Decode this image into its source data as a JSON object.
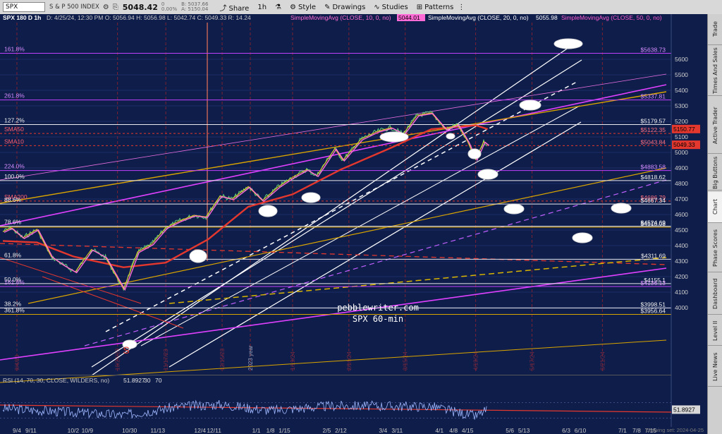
{
  "toolbar": {
    "symbol": "SPX",
    "description": "S & P 500 INDEX",
    "price": "5048.42",
    "change_line1": "0",
    "change_line2": "0.00%",
    "bid": "B: 5037.66",
    "ask": "A: 5150.04",
    "share_label": "Share",
    "timeframe_label": "1h",
    "style_label": "Style",
    "drawings_label": "Drawings",
    "studies_label": "Studies",
    "patterns_label": "Patterns"
  },
  "side_tabs": [
    "Trade",
    "Times And Sales",
    "Active Trader",
    "Big Buttons",
    "Chart",
    "Phase Scores",
    "Dashboard",
    "Level II",
    "Live News"
  ],
  "chart_header": {
    "title": "SPX 180 D 1h",
    "ohlc": "D: 4/25/24, 12:30 PM  O: 5056.94  H: 5056.98  L: 5042.74  C: 5049.33  R: 14.24",
    "sma10_label": "SimpleMovingAvg (CLOSE, 10, 0, no)",
    "sma10_value": "5044.01",
    "sma20_label": "SimpleMovingAvg (CLOSE, 20, 0, no)",
    "sma20_value": "5055.98",
    "sma50_label": "SimpleMovingAvg (CLOSE, 50, 0, no)"
  },
  "rsi_header": {
    "label": "RSI (14, 70, 30, CLOSE, WILDERS, no)",
    "value": "51.8927",
    "ob": "30",
    "os": "70"
  },
  "watermark": {
    "line1": "pebblewriter.com",
    "line2": "SPX 60-min"
  },
  "signature": "Drawing set: 2024-04-25",
  "s_marker": "S",
  "colors": {
    "background": "#0f1d4a",
    "sma10": "#ff6bd6",
    "sma20": "#f5d020",
    "sma50": "#e4382e",
    "fib": "#c040ff",
    "channel": "#ffffff",
    "gold": "#d9a400"
  },
  "chart_data": {
    "type": "line",
    "price_axis_ticks": [
      "5600",
      "5500",
      "5400",
      "5300",
      "5200",
      "5100",
      "5000",
      "4900",
      "4800",
      "4700",
      "4600",
      "4500",
      "4400",
      "4300",
      "4200",
      "4100",
      "4000"
    ],
    "x_tick_labels": [
      "9/4",
      "9/11",
      "10/2",
      "10/9",
      "10/30",
      "11/13",
      "12/4",
      "12/11",
      "1/1",
      "1/8",
      "1/15",
      "2/5",
      "2/12",
      "3/4",
      "3/11",
      "4/1",
      "4/8",
      "4/15",
      "5/6",
      "5/13",
      "6/3",
      "6/10",
      "7/1",
      "7/8",
      "7/15"
    ],
    "x_tick_dates": [
      "2023-09-04",
      "2023-09-11",
      "2023-10-02",
      "2023-10-09",
      "2023-10-30",
      "2023-11-13",
      "2023-12-04",
      "2023-12-11",
      "2024-01-01",
      "2024-01-08",
      "2024-01-15",
      "2024-02-05",
      "2024-02-12",
      "2024-03-04",
      "2024-03-11",
      "2024-04-01",
      "2024-04-08",
      "2024-04-15",
      "2024-05-06",
      "2024-05-13",
      "2024-06-03",
      "2024-06-10",
      "2024-07-01",
      "2024-07-08",
      "2024-07-15"
    ],
    "date_markers": [
      {
        "label": "9/4/23",
        "date": "2023-09-04"
      },
      {
        "label": "10/24/23",
        "date": "2023-10-24"
      },
      {
        "label": "11/17/23",
        "date": "2023-11-17"
      },
      {
        "label": "12/15/23",
        "date": "2023-12-15"
      },
      {
        "label": "2023 year",
        "date": "2023-12-29"
      },
      {
        "label": "1/19/24",
        "date": "2024-01-19"
      },
      {
        "label": "2/16/24",
        "date": "2024-02-16"
      },
      {
        "label": "3/15/24",
        "date": "2024-03-15"
      },
      {
        "label": "4/19/24",
        "date": "2024-04-19"
      },
      {
        "label": "5/17/24",
        "date": "2024-05-17"
      },
      {
        "label": "6/21/24",
        "date": "2024-06-21"
      }
    ],
    "level_labels": [
      {
        "label": "161.8%",
        "value": 5638.73,
        "right": "$5638.73",
        "style": "fib"
      },
      {
        "label": "261.8%",
        "value": 5337.81,
        "right": "$5337.81",
        "style": "fib"
      },
      {
        "label": "127.2%",
        "value": 5179.57,
        "right": "$5179.57",
        "style": "white"
      },
      {
        "label": "SMA50",
        "value": 5122.35,
        "right": "$5122.35",
        "style": "sma50"
      },
      {
        "label": "SMA10",
        "value": 5043.84,
        "right": "$5043.84",
        "style": "sma50"
      },
      {
        "label": "224.0%",
        "value": 4883.58,
        "right": "$4883.58",
        "style": "fib"
      },
      {
        "label": "100.0%",
        "value": 4818.62,
        "right": "$4818.62",
        "style": "white"
      },
      {
        "label": "SMA200",
        "value": 4686.79,
        "right": "$4686.79",
        "style": "sma50"
      },
      {
        "label": "88.6%",
        "value": 4667.34,
        "right": "$4667.34",
        "style": "white"
      },
      {
        "label": "78.6%",
        "value": 4524.69,
        "right": "$4524.69",
        "style": "white"
      },
      {
        "label": "",
        "value": 4518.08,
        "right": "$4518.08",
        "style": "gold"
      },
      {
        "label": "61.8%",
        "value": 4311.69,
        "right": "$4311.69",
        "style": "white"
      },
      {
        "label": "50.0%",
        "value": 4155.1,
        "right": "$4155.1",
        "style": "white"
      },
      {
        "label": "161.8%",
        "value": 4136.13,
        "right": "$4136.13",
        "style": "fib"
      },
      {
        "label": "38.2%",
        "value": 3998.51,
        "right": "$3998.51",
        "style": "white"
      },
      {
        "label": "361.8%",
        "value": 3956.64,
        "right": "$3956.64",
        "style": "gold"
      }
    ],
    "price_tags": [
      {
        "value": 5150.77,
        "label": "5150.77",
        "color": "#e4382e"
      },
      {
        "value": 5049.33,
        "label": "5049.33",
        "color": "#e4382e"
      }
    ],
    "price_series": {
      "name": "SPX",
      "points": [
        [
          "2023-08-28",
          4490
        ],
        [
          "2023-09-01",
          4515
        ],
        [
          "2023-09-07",
          4450
        ],
        [
          "2023-09-14",
          4505
        ],
        [
          "2023-09-21",
          4330
        ],
        [
          "2023-09-27",
          4275
        ],
        [
          "2023-10-03",
          4230
        ],
        [
          "2023-10-11",
          4375
        ],
        [
          "2023-10-18",
          4325
        ],
        [
          "2023-10-27",
          4120
        ],
        [
          "2023-11-03",
          4360
        ],
        [
          "2023-11-10",
          4410
        ],
        [
          "2023-11-17",
          4515
        ],
        [
          "2023-11-24",
          4560
        ],
        [
          "2023-12-01",
          4595
        ],
        [
          "2023-12-07",
          4585
        ],
        [
          "2023-12-14",
          4720
        ],
        [
          "2023-12-20",
          4700
        ],
        [
          "2023-12-28",
          4780
        ],
        [
          "2024-01-04",
          4690
        ],
        [
          "2024-01-12",
          4780
        ],
        [
          "2024-01-19",
          4840
        ],
        [
          "2024-01-26",
          4890
        ],
        [
          "2024-01-31",
          4850
        ],
        [
          "2024-02-09",
          5025
        ],
        [
          "2024-02-13",
          4950
        ],
        [
          "2024-02-22",
          5085
        ],
        [
          "2024-03-01",
          5135
        ],
        [
          "2024-03-08",
          5160
        ],
        [
          "2024-03-14",
          5120
        ],
        [
          "2024-03-21",
          5240
        ],
        [
          "2024-03-28",
          5255
        ],
        [
          "2024-04-04",
          5150
        ],
        [
          "2024-04-10",
          5180
        ],
        [
          "2024-04-15",
          5070
        ],
        [
          "2024-04-19",
          4955
        ],
        [
          "2024-04-23",
          5070
        ],
        [
          "2024-04-25",
          5049
        ]
      ]
    },
    "sma50_series": {
      "name": "SMA50",
      "points": [
        [
          "2023-08-28",
          4430
        ],
        [
          "2023-09-14",
          4420
        ],
        [
          "2023-10-02",
          4330
        ],
        [
          "2023-10-27",
          4260
        ],
        [
          "2023-11-17",
          4290
        ],
        [
          "2023-12-08",
          4440
        ],
        [
          "2023-12-28",
          4650
        ],
        [
          "2024-01-19",
          4730
        ],
        [
          "2024-02-12",
          4890
        ],
        [
          "2024-03-08",
          5030
        ],
        [
          "2024-03-28",
          5150
        ],
        [
          "2024-04-19",
          5175
        ],
        [
          "2024-04-25",
          5150
        ]
      ]
    },
    "rsi": {
      "value": 51.8927,
      "levels": [
        30,
        70
      ],
      "points": [
        [
          "2023-08-28",
          55
        ],
        [
          "2023-10-02",
          45
        ],
        [
          "2023-10-27",
          38
        ],
        [
          "2023-11-24",
          60
        ],
        [
          "2023-12-14",
          65
        ],
        [
          "2024-01-08",
          50
        ],
        [
          "2024-02-09",
          62
        ],
        [
          "2024-03-28",
          60
        ],
        [
          "2024-04-19",
          35
        ],
        [
          "2024-04-25",
          52
        ]
      ]
    }
  }
}
